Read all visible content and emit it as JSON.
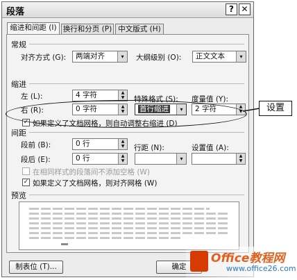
{
  "window": {
    "title": "段落",
    "help_label": "?",
    "close_label": "✕"
  },
  "tabs": [
    {
      "label": "缩进和间距 (I)",
      "active": true
    },
    {
      "label": "换行和分页 (P)",
      "active": false
    },
    {
      "label": "中文版式 (H)",
      "active": false
    }
  ],
  "general": {
    "heading": "常规",
    "alignment_label": "对齐方式 (G):",
    "alignment_value": "两端对齐",
    "outline_label": "大纲级别 (O):",
    "outline_value": "正文文本"
  },
  "indent": {
    "heading": "缩进",
    "left_label": "左 (L):",
    "left_value": "4 字符",
    "right_label": "右 (R):",
    "right_value": "0 字符",
    "special_label": "特殊格式 (S):",
    "special_value": "首行缩进",
    "measure_label": "度量值 (Y):",
    "measure_value": "2 字符",
    "grid_adjust_label": "如果定义了文档网格，则自动调整右缩进 (D)",
    "grid_adjust_checked": true
  },
  "spacing": {
    "heading": "间距",
    "before_label": "段前 (B):",
    "before_value": "0 行",
    "after_label": "段后 (E):",
    "after_value": "0 行",
    "line_label": "行距 (N):",
    "line_value": "",
    "setting_label": "设置值 (A):",
    "setting_value": "",
    "same_style_label": "在相同样式的段落间不添加空格 (W)",
    "same_style_checked": false,
    "grid_align_label": "如果定义了文档网格，则对齐网格 (W)",
    "grid_align_checked": true
  },
  "preview": {
    "heading": "预览"
  },
  "buttons": {
    "tabs_label": "制表位 (T)...",
    "ok_label": "确定"
  },
  "callout": {
    "label": "设置"
  },
  "watermark": {
    "main": "Office教程网",
    "sub": "www.office26.com"
  },
  "icons": {
    "check": "✓",
    "arrow_down": "▾",
    "spin_up": "▲",
    "spin_down": "▼"
  },
  "colors": {
    "logo_orange": "#e1621f",
    "logo_red": "#d83b01",
    "logo_blue": "#2a78c6"
  }
}
